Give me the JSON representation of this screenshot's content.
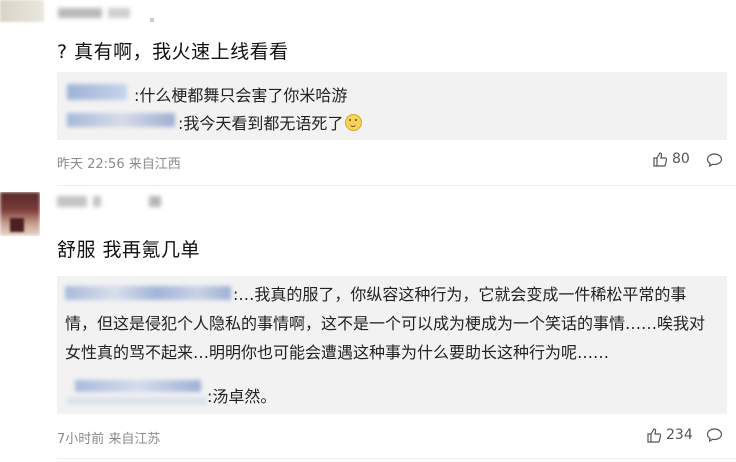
{
  "comments": [
    {
      "text": "? 真有啊，我火速上线看看",
      "replies": [
        {
          "text": ":什么梗都舞只会害了你米哈游"
        },
        {
          "text": ":我今天看到都无语死了"
        }
      ],
      "meta": "昨天 22:56 来自江西",
      "likes": "80"
    },
    {
      "text": "舒服 我再氪几单",
      "replies": [
        {
          "text": ":…我真的服了，你纵容这种行为，它就会变成一件稀松平常的事情，但这是侵犯个人隐私的事情啊，这不是一个可以成为梗成为一个笑话的事情……唉我对女性真的骂不起来…明明你也可能会遭遇这种事为什么要助长这种行为呢……"
        },
        {
          "text": ":汤卓然。"
        }
      ],
      "meta": "7小时前 来自江苏",
      "likes": "234"
    }
  ],
  "icons": {
    "like": "thumbs-up-icon",
    "reply": "comment-bubble-icon"
  }
}
